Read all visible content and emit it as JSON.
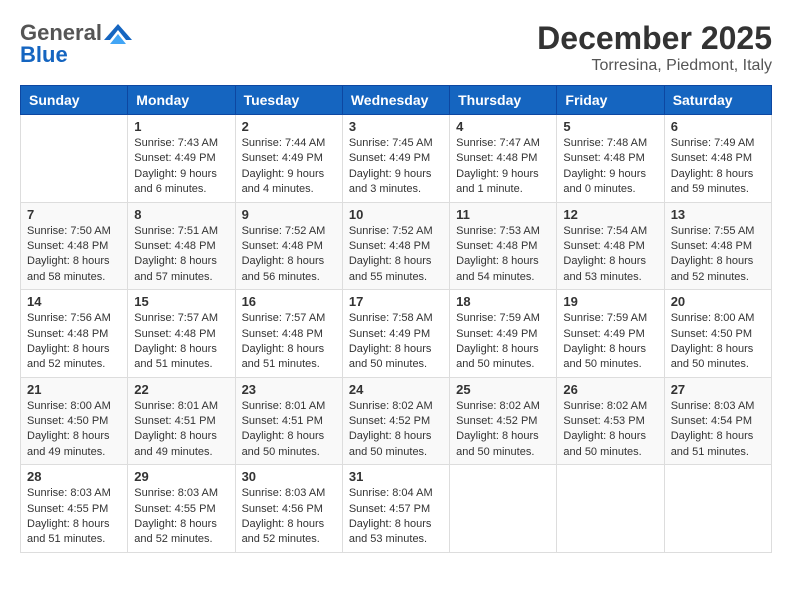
{
  "logo": {
    "general": "General",
    "blue": "Blue"
  },
  "header": {
    "month": "December 2025",
    "location": "Torresina, Piedmont, Italy"
  },
  "days_of_week": [
    "Sunday",
    "Monday",
    "Tuesday",
    "Wednesday",
    "Thursday",
    "Friday",
    "Saturday"
  ],
  "weeks": [
    [
      {
        "day": "",
        "sunrise": "",
        "sunset": "",
        "daylight": ""
      },
      {
        "day": "1",
        "sunrise": "Sunrise: 7:43 AM",
        "sunset": "Sunset: 4:49 PM",
        "daylight": "Daylight: 9 hours and 6 minutes."
      },
      {
        "day": "2",
        "sunrise": "Sunrise: 7:44 AM",
        "sunset": "Sunset: 4:49 PM",
        "daylight": "Daylight: 9 hours and 4 minutes."
      },
      {
        "day": "3",
        "sunrise": "Sunrise: 7:45 AM",
        "sunset": "Sunset: 4:49 PM",
        "daylight": "Daylight: 9 hours and 3 minutes."
      },
      {
        "day": "4",
        "sunrise": "Sunrise: 7:47 AM",
        "sunset": "Sunset: 4:48 PM",
        "daylight": "Daylight: 9 hours and 1 minute."
      },
      {
        "day": "5",
        "sunrise": "Sunrise: 7:48 AM",
        "sunset": "Sunset: 4:48 PM",
        "daylight": "Daylight: 9 hours and 0 minutes."
      },
      {
        "day": "6",
        "sunrise": "Sunrise: 7:49 AM",
        "sunset": "Sunset: 4:48 PM",
        "daylight": "Daylight: 8 hours and 59 minutes."
      }
    ],
    [
      {
        "day": "7",
        "sunrise": "Sunrise: 7:50 AM",
        "sunset": "Sunset: 4:48 PM",
        "daylight": "Daylight: 8 hours and 58 minutes."
      },
      {
        "day": "8",
        "sunrise": "Sunrise: 7:51 AM",
        "sunset": "Sunset: 4:48 PM",
        "daylight": "Daylight: 8 hours and 57 minutes."
      },
      {
        "day": "9",
        "sunrise": "Sunrise: 7:52 AM",
        "sunset": "Sunset: 4:48 PM",
        "daylight": "Daylight: 8 hours and 56 minutes."
      },
      {
        "day": "10",
        "sunrise": "Sunrise: 7:52 AM",
        "sunset": "Sunset: 4:48 PM",
        "daylight": "Daylight: 8 hours and 55 minutes."
      },
      {
        "day": "11",
        "sunrise": "Sunrise: 7:53 AM",
        "sunset": "Sunset: 4:48 PM",
        "daylight": "Daylight: 8 hours and 54 minutes."
      },
      {
        "day": "12",
        "sunrise": "Sunrise: 7:54 AM",
        "sunset": "Sunset: 4:48 PM",
        "daylight": "Daylight: 8 hours and 53 minutes."
      },
      {
        "day": "13",
        "sunrise": "Sunrise: 7:55 AM",
        "sunset": "Sunset: 4:48 PM",
        "daylight": "Daylight: 8 hours and 52 minutes."
      }
    ],
    [
      {
        "day": "14",
        "sunrise": "Sunrise: 7:56 AM",
        "sunset": "Sunset: 4:48 PM",
        "daylight": "Daylight: 8 hours and 52 minutes."
      },
      {
        "day": "15",
        "sunrise": "Sunrise: 7:57 AM",
        "sunset": "Sunset: 4:48 PM",
        "daylight": "Daylight: 8 hours and 51 minutes."
      },
      {
        "day": "16",
        "sunrise": "Sunrise: 7:57 AM",
        "sunset": "Sunset: 4:48 PM",
        "daylight": "Daylight: 8 hours and 51 minutes."
      },
      {
        "day": "17",
        "sunrise": "Sunrise: 7:58 AM",
        "sunset": "Sunset: 4:49 PM",
        "daylight": "Daylight: 8 hours and 50 minutes."
      },
      {
        "day": "18",
        "sunrise": "Sunrise: 7:59 AM",
        "sunset": "Sunset: 4:49 PM",
        "daylight": "Daylight: 8 hours and 50 minutes."
      },
      {
        "day": "19",
        "sunrise": "Sunrise: 7:59 AM",
        "sunset": "Sunset: 4:49 PM",
        "daylight": "Daylight: 8 hours and 50 minutes."
      },
      {
        "day": "20",
        "sunrise": "Sunrise: 8:00 AM",
        "sunset": "Sunset: 4:50 PM",
        "daylight": "Daylight: 8 hours and 50 minutes."
      }
    ],
    [
      {
        "day": "21",
        "sunrise": "Sunrise: 8:00 AM",
        "sunset": "Sunset: 4:50 PM",
        "daylight": "Daylight: 8 hours and 49 minutes."
      },
      {
        "day": "22",
        "sunrise": "Sunrise: 8:01 AM",
        "sunset": "Sunset: 4:51 PM",
        "daylight": "Daylight: 8 hours and 49 minutes."
      },
      {
        "day": "23",
        "sunrise": "Sunrise: 8:01 AM",
        "sunset": "Sunset: 4:51 PM",
        "daylight": "Daylight: 8 hours and 50 minutes."
      },
      {
        "day": "24",
        "sunrise": "Sunrise: 8:02 AM",
        "sunset": "Sunset: 4:52 PM",
        "daylight": "Daylight: 8 hours and 50 minutes."
      },
      {
        "day": "25",
        "sunrise": "Sunrise: 8:02 AM",
        "sunset": "Sunset: 4:52 PM",
        "daylight": "Daylight: 8 hours and 50 minutes."
      },
      {
        "day": "26",
        "sunrise": "Sunrise: 8:02 AM",
        "sunset": "Sunset: 4:53 PM",
        "daylight": "Daylight: 8 hours and 50 minutes."
      },
      {
        "day": "27",
        "sunrise": "Sunrise: 8:03 AM",
        "sunset": "Sunset: 4:54 PM",
        "daylight": "Daylight: 8 hours and 51 minutes."
      }
    ],
    [
      {
        "day": "28",
        "sunrise": "Sunrise: 8:03 AM",
        "sunset": "Sunset: 4:55 PM",
        "daylight": "Daylight: 8 hours and 51 minutes."
      },
      {
        "day": "29",
        "sunrise": "Sunrise: 8:03 AM",
        "sunset": "Sunset: 4:55 PM",
        "daylight": "Daylight: 8 hours and 52 minutes."
      },
      {
        "day": "30",
        "sunrise": "Sunrise: 8:03 AM",
        "sunset": "Sunset: 4:56 PM",
        "daylight": "Daylight: 8 hours and 52 minutes."
      },
      {
        "day": "31",
        "sunrise": "Sunrise: 8:04 AM",
        "sunset": "Sunset: 4:57 PM",
        "daylight": "Daylight: 8 hours and 53 minutes."
      },
      {
        "day": "",
        "sunrise": "",
        "sunset": "",
        "daylight": ""
      },
      {
        "day": "",
        "sunrise": "",
        "sunset": "",
        "daylight": ""
      },
      {
        "day": "",
        "sunrise": "",
        "sunset": "",
        "daylight": ""
      }
    ]
  ]
}
